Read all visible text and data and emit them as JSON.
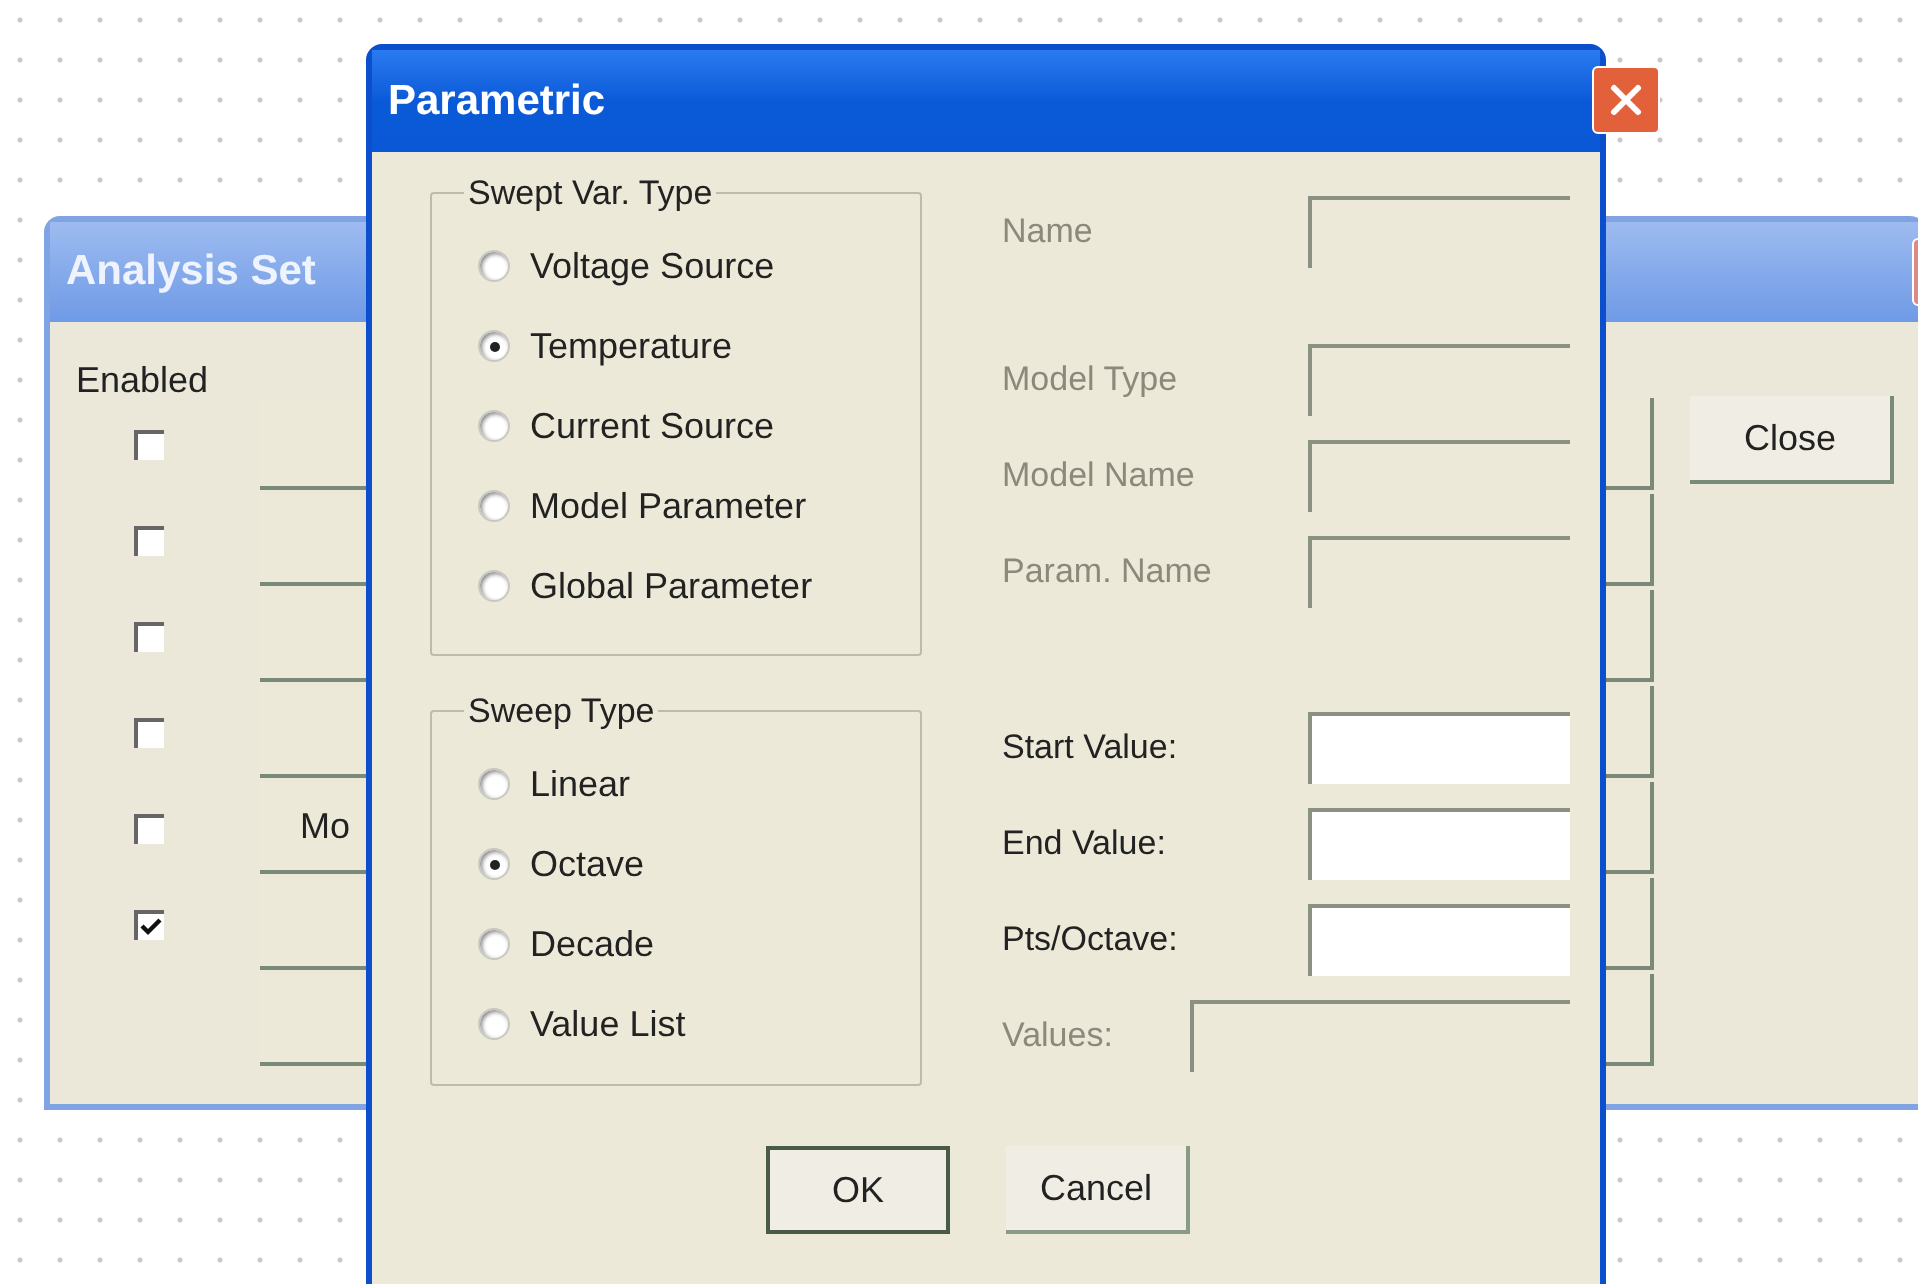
{
  "analysis_window": {
    "title": "Analysis Set",
    "enabled_label": "Enabled",
    "close_button": "Close",
    "rows": [
      {
        "kind": "checkbox",
        "checked": false
      },
      {
        "kind": "checkbox",
        "checked": false
      },
      {
        "kind": "checkbox",
        "checked": false
      },
      {
        "kind": "checkbox",
        "checked": false
      },
      {
        "kind": "checkbox",
        "checked": false,
        "button_label": "Mo"
      },
      {
        "kind": "checkbox",
        "checked": true
      },
      {
        "kind": "plain"
      }
    ]
  },
  "dialog": {
    "title": "Parametric",
    "swept_var_type": {
      "label": "Swept Var. Type",
      "options": [
        {
          "label": "Voltage Source",
          "selected": false
        },
        {
          "label": "Temperature",
          "selected": true
        },
        {
          "label": "Current Source",
          "selected": false
        },
        {
          "label": "Model Parameter",
          "selected": false
        },
        {
          "label": "Global Parameter",
          "selected": false
        }
      ]
    },
    "sweep_type": {
      "label": "Sweep Type",
      "options": [
        {
          "label": "Linear",
          "selected": false
        },
        {
          "label": "Octave",
          "selected": true
        },
        {
          "label": "Decade",
          "selected": false
        },
        {
          "label": "Value List",
          "selected": false
        }
      ]
    },
    "name_fields": [
      {
        "label": "Name",
        "disabled": true
      }
    ],
    "model_fields": [
      {
        "label": "Model Type",
        "disabled": true
      },
      {
        "label": "Model Name",
        "disabled": true
      },
      {
        "label": "Param. Name",
        "disabled": true
      }
    ],
    "value_fields": [
      {
        "label": "Start Value:",
        "disabled": false
      },
      {
        "label": "End Value:",
        "disabled": false
      },
      {
        "label": "Pts/Octave:",
        "disabled": false
      }
    ],
    "values_field": {
      "label": "Values:",
      "disabled": true
    },
    "buttons": [
      {
        "label": "OK",
        "default": true
      },
      {
        "label": "Cancel",
        "default": false
      }
    ]
  }
}
